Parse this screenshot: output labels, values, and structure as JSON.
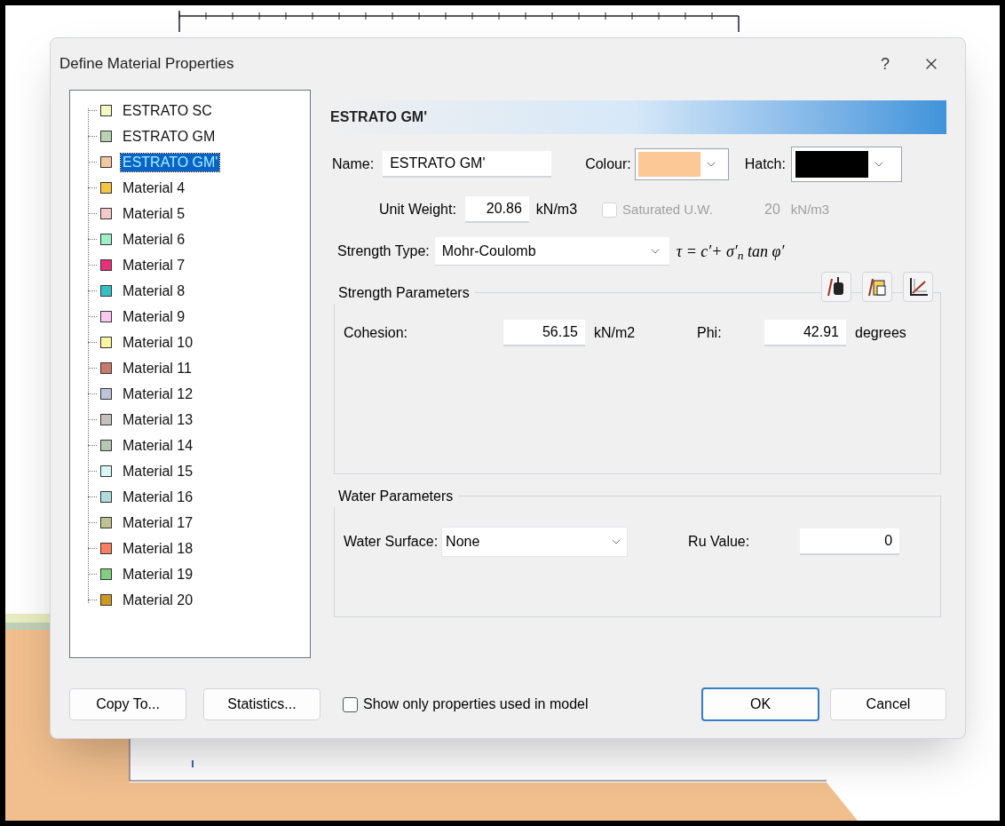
{
  "window": {
    "title": "Define Material Properties",
    "help": "?"
  },
  "materials": [
    {
      "name": "ESTRATO SC",
      "color": "#f7f7c4",
      "selected": false
    },
    {
      "name": "ESTRATO GM",
      "color": "#b9d2b0",
      "selected": false
    },
    {
      "name": "ESTRATO GM'",
      "color": "#f5c7a0",
      "selected": true
    },
    {
      "name": "Material 4",
      "color": "#f5c542",
      "selected": false
    },
    {
      "name": "Material 5",
      "color": "#f5c9c9",
      "selected": false
    },
    {
      "name": "Material 6",
      "color": "#9ff0c8",
      "selected": false
    },
    {
      "name": "Material 7",
      "color": "#e8307a",
      "selected": false
    },
    {
      "name": "Material 8",
      "color": "#36c0c4",
      "selected": false
    },
    {
      "name": "Material 9",
      "color": "#f9c9f2",
      "selected": false
    },
    {
      "name": "Material 10",
      "color": "#f9f5a0",
      "selected": false
    },
    {
      "name": "Material 11",
      "color": "#c87b6a",
      "selected": false
    },
    {
      "name": "Material 12",
      "color": "#c0c4d8",
      "selected": false
    },
    {
      "name": "Material 13",
      "color": "#c8c0bc",
      "selected": false
    },
    {
      "name": "Material 14",
      "color": "#b4c8b4",
      "selected": false
    },
    {
      "name": "Material 15",
      "color": "#d8f8f8",
      "selected": false
    },
    {
      "name": "Material 16",
      "color": "#b0dcdc",
      "selected": false
    },
    {
      "name": "Material 17",
      "color": "#c0c090",
      "selected": false
    },
    {
      "name": "Material 18",
      "color": "#f88060",
      "selected": false
    },
    {
      "name": "Material 19",
      "color": "#80d080",
      "selected": false
    },
    {
      "name": "Material 20",
      "color": "#cc9a20",
      "selected": false
    }
  ],
  "header": "ESTRATO GM'",
  "name_field": {
    "label": "Name:",
    "value": "ESTRATO GM'"
  },
  "colour": {
    "label": "Colour:",
    "color": "#fbc896"
  },
  "hatch": {
    "label": "Hatch:",
    "color": "#000000"
  },
  "unit_weight": {
    "label": "Unit Weight:",
    "value": "20.86",
    "unit": "kN/m3"
  },
  "saturated": {
    "label": "Saturated U.W.",
    "checked": false,
    "disabled": true,
    "value": "20",
    "unit": "kN/m3"
  },
  "strength_type": {
    "label": "Strength Type:",
    "value": "Mohr-Coulomb",
    "formula": "τ = c′+ σ′$_{n}$ tan φ′"
  },
  "strength_parameters": {
    "title": "Strength Parameters",
    "cohesion": {
      "label": "Cohesion:",
      "value": "56.15",
      "unit": "kN/m2"
    },
    "phi": {
      "label": "Phi:",
      "value": "42.91",
      "unit": "degrees"
    }
  },
  "water_parameters": {
    "title": "Water Parameters",
    "water_surface": {
      "label": "Water Surface:",
      "value": "None"
    },
    "ru": {
      "label": "Ru Value:",
      "value": "0"
    }
  },
  "footer": {
    "copy_to": "Copy To...",
    "statistics": "Statistics...",
    "show_only": {
      "label": "Show only properties used in model",
      "checked": false
    },
    "ok": "OK",
    "cancel": "Cancel"
  }
}
